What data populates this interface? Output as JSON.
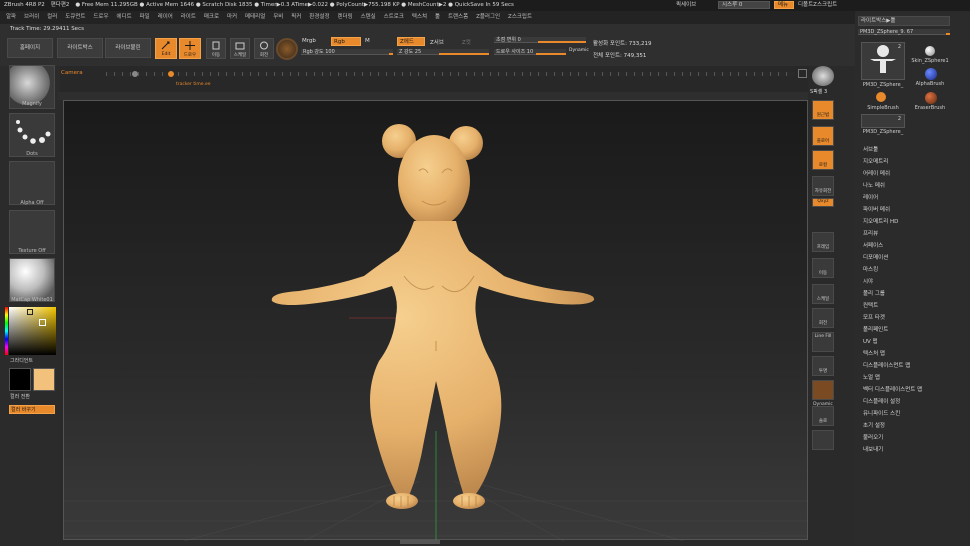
{
  "titlebar": {
    "items": [
      "ZBrush 4R8 P2",
      "편다편2",
      "● Free Mem 11.295GB ● Active Mem 1646 ● Scratch Disk 1835 ● Timer▶0.3 ATime▶0.022 ● PolyCount▶755.198 KP ● MeshCount▶2 ● QuickSave In 59 Secs"
    ],
    "right": {
      "label1": "퀵세이브",
      "label2": "시스루 0",
      "menu": "메뉴",
      "script": "디폴트Z스크립트"
    }
  },
  "menubar": {
    "items": [
      "알파",
      "브러쉬",
      "컬러",
      "도큐먼트",
      "드로우",
      "에디트",
      "파일",
      "레이어",
      "라이트",
      "매크로",
      "마커",
      "메테리얼",
      "무비",
      "픽커",
      "환경설정",
      "렌더링",
      "스텐실",
      "스트로크",
      "텍스쳐",
      "툴",
      "트랜스폼",
      "Z플러그인",
      "Z스크립트"
    ]
  },
  "toolbar": {
    "track_time": "Track Time: 29.29411 Secs",
    "home": "홈페이지",
    "lightbox": "라이트박스",
    "lightbox_live": "라이브불린",
    "edit": "Edit",
    "draw": "드로우",
    "move": "이동",
    "scale": "스케일",
    "rotate": "회전",
    "mrgb": "Mrgb",
    "rgb": "Rgb",
    "m": "M",
    "rgb_intensity": "Rgb 강도 100",
    "zadd": "Z에드",
    "zsub": "Z서브",
    "zcut": "Z컷",
    "z_intensity": "Z 강도 25",
    "focal_shift": "초점 변위 0",
    "draw_size": "드로우 사이즈 10",
    "dynamic": "Dynamic",
    "active_points": "활성화 포인트: 733,219",
    "total_points": "전체 포인트: 749,351"
  },
  "timeline": {
    "camera_label": "Camera",
    "marker_label": "tracker time.ee"
  },
  "leftpanel": {
    "brush_label": "Magnify",
    "stroke_label": "Dots",
    "alpha_label": "Alpha Off",
    "texture_label": "Texture Off",
    "material_label": "MatCap White01",
    "gradient_label": "그라디언트",
    "switch_label": "컬러 전환",
    "change_label": "컬러 바꾸기"
  },
  "shelf": {
    "spix": "S픽셀 3",
    "buttons": [
      "원근법",
      "플로어",
      "로컬",
      "자유회전",
      "Qxyz",
      "프레임",
      "이동",
      "스케일",
      "회전",
      "Line Fill",
      "투명",
      "Dynamic",
      "솔로"
    ]
  },
  "rpanel": {
    "header": "라이트박스▶툴",
    "tool_name": "PM3D_ZSphere_9. 67",
    "tools": [
      {
        "label": "PM3D_ZSphere_",
        "count": "2"
      },
      {
        "label": "Skin_ZSphere1",
        "count": ""
      },
      {
        "label": "SimpleBrush",
        "count": ""
      },
      {
        "label": "AlphaBrush",
        "count": ""
      },
      {
        "label": "EraserBrush",
        "count": ""
      },
      {
        "label": "PM3D_ZSphere_",
        "count": "2"
      }
    ],
    "list": [
      "서브툴",
      "지오메트리",
      "어레이 메쉬",
      "나노 메쉬",
      "레이어",
      "파이버 메쉬",
      "지오메트리 HD",
      "프리뷰",
      "서페이스",
      "디포메이션",
      "마스킹",
      "시야",
      "폴리 그룹",
      "컨택트",
      "모프 타겟",
      "폴리페인트",
      "UV 맵",
      "텍스처 맵",
      "디스플레이스먼트 맵",
      "노멀 맵",
      "벡터 디스플레이스먼트 맵",
      "디스플레이 설정",
      "유니파이드 스킨",
      "초기 설정",
      "불러오기",
      "내보내기"
    ]
  },
  "colors": {
    "accent": "#e8892b",
    "figure": "#e8b870",
    "secondary_color": "#f2c27c"
  }
}
